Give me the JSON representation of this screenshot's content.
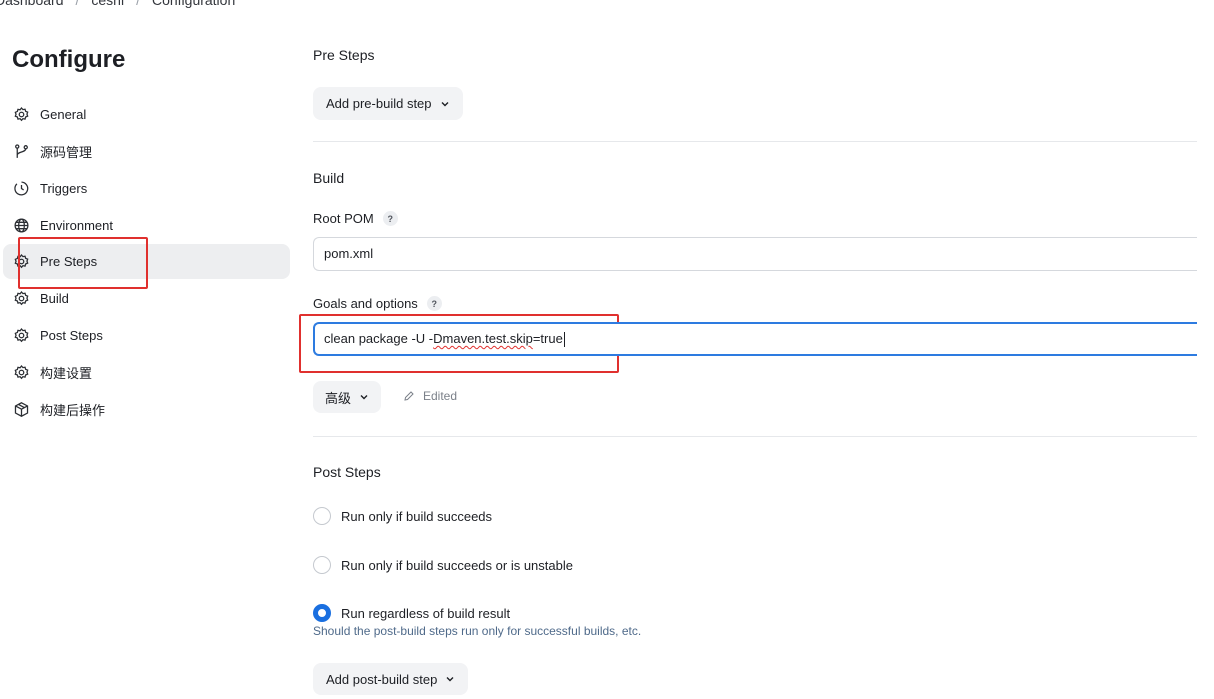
{
  "breadcrumb": {
    "items": [
      "Dashboard",
      "ceshi",
      "Configuration"
    ],
    "separator": "/"
  },
  "sidebar": {
    "title": "Configure",
    "items": [
      {
        "label": "General",
        "icon": "gear-icon"
      },
      {
        "label": "源码管理",
        "icon": "branch-icon"
      },
      {
        "label": "Triggers",
        "icon": "clock-icon"
      },
      {
        "label": "Environment",
        "icon": "globe-icon"
      },
      {
        "label": "Pre Steps",
        "icon": "gear-icon",
        "active": true
      },
      {
        "label": "Build",
        "icon": "gear-icon"
      },
      {
        "label": "Post Steps",
        "icon": "gear-icon"
      },
      {
        "label": "构建设置",
        "icon": "gear-icon"
      },
      {
        "label": "构建后操作",
        "icon": "package-icon"
      }
    ]
  },
  "pre_steps": {
    "title": "Pre Steps",
    "add_button": "Add pre-build step"
  },
  "build": {
    "title": "Build",
    "root_pom_label": "Root POM",
    "root_pom_value": "pom.xml",
    "goals_label": "Goals and options",
    "goals_value_prefix": "clean package -U -",
    "goals_value_misspelled": "Dmaven.test.skip",
    "goals_value_suffix": "=true",
    "help_glyph": "?",
    "advanced_button": "高级",
    "edited_label": "Edited"
  },
  "post_steps": {
    "title": "Post Steps",
    "options": [
      {
        "label": "Run only if build succeeds",
        "checked": false
      },
      {
        "label": "Run only if build succeeds or is unstable",
        "checked": false
      },
      {
        "label": "Run regardless of build result",
        "checked": true
      }
    ],
    "description": "Should the post-build steps run only for successful builds, etc.",
    "add_button": "Add post-build step"
  },
  "colors": {
    "highlight_box": "#e0302e",
    "focus_border": "#2d7be0",
    "radio_checked": "#1a6fe0",
    "active_nav_bg": "#edeef0"
  }
}
